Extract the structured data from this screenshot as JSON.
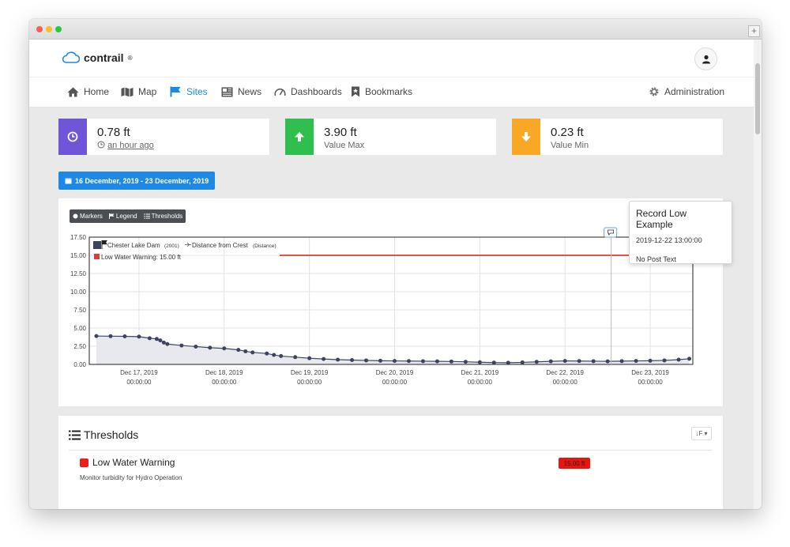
{
  "browser": {
    "new_tab_label": "+"
  },
  "app": {
    "logo_text": "contrail",
    "logo_mark": "®"
  },
  "nav": {
    "items": [
      {
        "label": "Home",
        "icon": "home-icon"
      },
      {
        "label": "Map",
        "icon": "map-icon"
      },
      {
        "label": "Sites",
        "icon": "flag-icon",
        "active": true
      },
      {
        "label": "News",
        "icon": "newspaper-icon"
      },
      {
        "label": "Dashboards",
        "icon": "gauge-icon"
      },
      {
        "label": "Bookmarks",
        "icon": "bookmark-icon"
      }
    ],
    "admin_label": "Administration"
  },
  "stats": [
    {
      "value": "0.78 ft",
      "sub": "an hour ago",
      "color": "#6f56d9",
      "icon": "clock-icon"
    },
    {
      "value": "3.90 ft",
      "sub": "Value Max",
      "color": "#2fbf4f",
      "icon": "arrow-up-icon"
    },
    {
      "value": "0.23 ft",
      "sub": "Value Min",
      "color": "#f9a825",
      "icon": "arrow-down-icon"
    }
  ],
  "date_range": "16 December, 2019 - 23 December, 2019",
  "chart_toolbar": {
    "markers": "Markers",
    "legend": "Legend",
    "thresholds": "Thresholds"
  },
  "tooltip": {
    "title": "Record Low Example",
    "date": "2019-12-22 13:00:00",
    "body": "No Post Text"
  },
  "legend": {
    "site": "Chester Lake Dam",
    "site_code": "(2001)",
    "series": "Distance from Crest",
    "series_note": "(Distance)",
    "threshold": "Low Water Warning: 15.00 ft"
  },
  "chart_data": {
    "type": "area",
    "ylim": [
      0,
      17.5
    ],
    "yticks": [
      "17.50",
      "15.00",
      "12.50",
      "10.00",
      "7.50",
      "5.00",
      "2.50",
      "0.00"
    ],
    "xticks": [
      {
        "date": "Dec 17, 2019",
        "time": "00:00:00"
      },
      {
        "date": "Dec 18, 2019",
        "time": "00:00:00"
      },
      {
        "date": "Dec 19, 2019",
        "time": "00:00:00"
      },
      {
        "date": "Dec 20, 2019",
        "time": "00:00:00"
      },
      {
        "date": "Dec 21, 2019",
        "time": "00:00:00"
      },
      {
        "date": "Dec 22, 2019",
        "time": "00:00:00"
      },
      {
        "date": "Dec 23, 2019",
        "time": "00:00:00"
      }
    ],
    "x_start": "2019-12-16 10:00",
    "x_end": "2019-12-23 12:00",
    "threshold": {
      "value": 15.0,
      "color": "#e53935"
    },
    "series": [
      {
        "name": "Distance from Crest",
        "color": "#3d4462",
        "points": [
          [
            "2019-12-16 12:00",
            3.9
          ],
          [
            "2019-12-16 16:00",
            3.88
          ],
          [
            "2019-12-16 20:00",
            3.86
          ],
          [
            "2019-12-17 00:00",
            3.82
          ],
          [
            "2019-12-17 03:00",
            3.6
          ],
          [
            "2019-12-17 05:00",
            3.5
          ],
          [
            "2019-12-17 06:00",
            3.3
          ],
          [
            "2019-12-17 07:00",
            3.0
          ],
          [
            "2019-12-17 08:00",
            2.8
          ],
          [
            "2019-12-17 12:00",
            2.6
          ],
          [
            "2019-12-17 16:00",
            2.45
          ],
          [
            "2019-12-17 20:00",
            2.3
          ],
          [
            "2019-12-18 00:00",
            2.2
          ],
          [
            "2019-12-18 04:00",
            2.0
          ],
          [
            "2019-12-18 06:00",
            1.8
          ],
          [
            "2019-12-18 08:00",
            1.65
          ],
          [
            "2019-12-18 12:00",
            1.5
          ],
          [
            "2019-12-18 14:00",
            1.3
          ],
          [
            "2019-12-18 16:00",
            1.15
          ],
          [
            "2019-12-18 20:00",
            1.0
          ],
          [
            "2019-12-19 00:00",
            0.85
          ],
          [
            "2019-12-19 04:00",
            0.75
          ],
          [
            "2019-12-19 08:00",
            0.65
          ],
          [
            "2019-12-19 12:00",
            0.6
          ],
          [
            "2019-12-19 16:00",
            0.55
          ],
          [
            "2019-12-19 20:00",
            0.5
          ],
          [
            "2019-12-20 00:00",
            0.48
          ],
          [
            "2019-12-20 04:00",
            0.46
          ],
          [
            "2019-12-20 08:00",
            0.44
          ],
          [
            "2019-12-20 12:00",
            0.42
          ],
          [
            "2019-12-20 16:00",
            0.4
          ],
          [
            "2019-12-20 20:00",
            0.36
          ],
          [
            "2019-12-21 00:00",
            0.3
          ],
          [
            "2019-12-21 04:00",
            0.25
          ],
          [
            "2019-12-21 08:00",
            0.23
          ],
          [
            "2019-12-21 12:00",
            0.28
          ],
          [
            "2019-12-21 16:00",
            0.35
          ],
          [
            "2019-12-21 20:00",
            0.42
          ],
          [
            "2019-12-22 00:00",
            0.48
          ],
          [
            "2019-12-22 04:00",
            0.46
          ],
          [
            "2019-12-22 08:00",
            0.44
          ],
          [
            "2019-12-22 12:00",
            0.42
          ],
          [
            "2019-12-22 16:00",
            0.45
          ],
          [
            "2019-12-22 20:00",
            0.48
          ],
          [
            "2019-12-23 00:00",
            0.5
          ],
          [
            "2019-12-23 04:00",
            0.55
          ],
          [
            "2019-12-23 08:00",
            0.65
          ],
          [
            "2019-12-23 11:00",
            0.78
          ]
        ]
      }
    ],
    "marker": {
      "date": "2019-12-22 13:00",
      "label": "Record Low Example"
    }
  },
  "thresholds": {
    "title": "Thresholds",
    "sort_label": "↓F ▾",
    "items": [
      {
        "name": "Low Water Warning",
        "description": "Monitor turbidity for Hydro Operation",
        "value": "15.00 ft",
        "color": "#e8140f"
      }
    ]
  }
}
